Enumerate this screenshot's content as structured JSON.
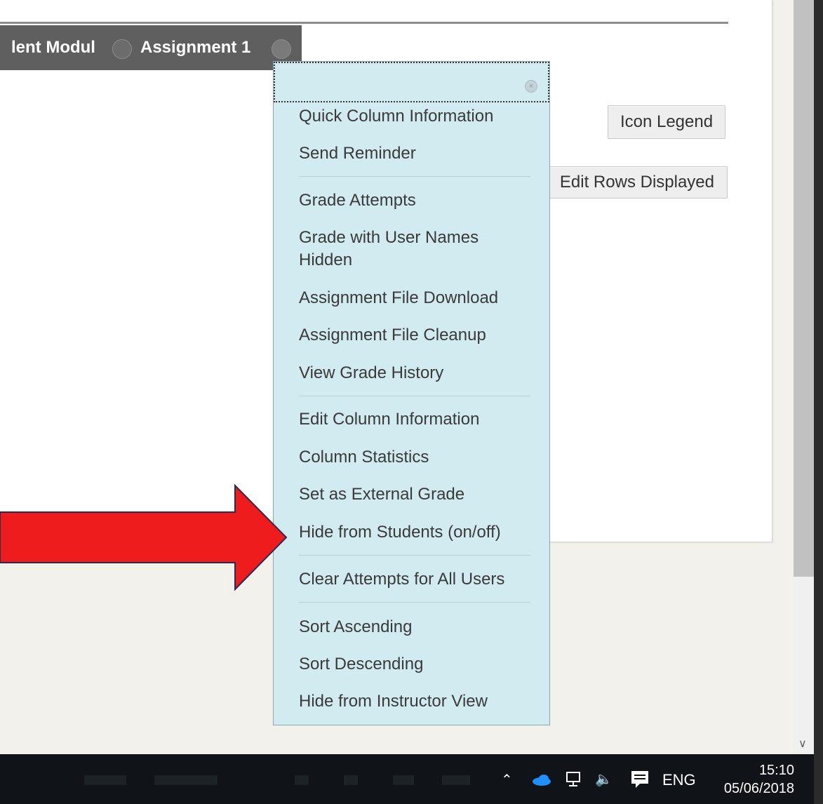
{
  "header": {
    "breadcrumb_prev": "lent Modul",
    "breadcrumb_current": "Assignment 1"
  },
  "buttons": {
    "icon_legend": "Icon Legend",
    "edit_rows": "Edit Rows Displayed"
  },
  "context_menu": {
    "groups": [
      [
        "Quick Column Information",
        "Send Reminder"
      ],
      [
        "Grade Attempts",
        "Grade with User Names Hidden",
        "Assignment File Download",
        "Assignment File Cleanup",
        "View Grade History"
      ],
      [
        "Edit Column Information",
        "Column Statistics",
        "Set as External Grade",
        "Hide from Students (on/off)"
      ],
      [
        "Clear Attempts for All Users"
      ],
      [
        "Sort Ascending",
        "Sort Descending",
        "Hide from Instructor View"
      ]
    ],
    "items": {
      "quick_column_information": "Quick Column Information",
      "send_reminder": "Send Reminder",
      "grade_attempts": "Grade Attempts",
      "grade_user_names_hidden_line1": "Grade with User Names",
      "grade_user_names_hidden_line2": "Hidden",
      "assignment_file_download": "Assignment File Download",
      "assignment_file_cleanup": "Assignment File Cleanup",
      "view_grade_history": "View Grade History",
      "edit_column_information": "Edit Column Information",
      "column_statistics": "Column Statistics",
      "set_as_external_grade": "Set as External Grade",
      "hide_from_students": "Hide from Students (on/off)",
      "clear_attempts": "Clear Attempts for All Users",
      "sort_ascending": "Sort Ascending",
      "sort_descending": "Sort Descending",
      "hide_from_instructor_view": "Hide from Instructor View"
    }
  },
  "annotation": {
    "arrow_color": "#ee1c1c",
    "arrow_outline": "#2a2a55",
    "points_to": "Hide from Students (on/off)"
  },
  "taskbar": {
    "language": "ENG",
    "time": "15:10",
    "date": "05/06/2018"
  },
  "colors": {
    "menu_bg": "#d1ebf1",
    "header_bg": "#5f5f5f",
    "taskbar_bg": "#101418"
  }
}
